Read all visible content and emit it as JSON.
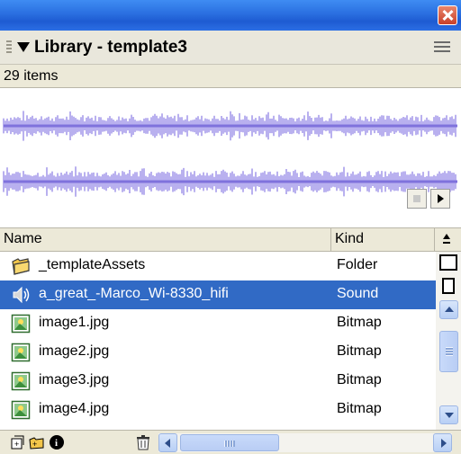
{
  "panel": {
    "title": "Library - template3",
    "item_count": "29 items"
  },
  "columns": {
    "name": "Name",
    "kind": "Kind"
  },
  "items": [
    {
      "name": "_templateAssets",
      "kind": "Folder",
      "icon": "folder-icon",
      "selected": false
    },
    {
      "name": "a_great_-Marco_Wi-8330_hifi",
      "kind": "Sound",
      "icon": "sound-icon",
      "selected": true
    },
    {
      "name": "image1.jpg",
      "kind": "Bitmap",
      "icon": "bitmap-icon",
      "selected": false
    },
    {
      "name": "image2.jpg",
      "kind": "Bitmap",
      "icon": "bitmap-icon",
      "selected": false
    },
    {
      "name": "image3.jpg",
      "kind": "Bitmap",
      "icon": "bitmap-icon",
      "selected": false
    },
    {
      "name": "image4.jpg",
      "kind": "Bitmap",
      "icon": "bitmap-icon",
      "selected": false
    }
  ],
  "colors": {
    "title_bar": "#2a6fe0",
    "selection": "#316ac5",
    "waveform": "#9b8fe8",
    "panel_bg": "#ece9d8"
  },
  "icons": [
    "close-icon",
    "collapse-arrow-icon",
    "panel-menu-icon",
    "stop-icon",
    "play-icon",
    "sort-icon",
    "new-symbol-icon",
    "new-folder-icon",
    "properties-icon",
    "delete-icon"
  ]
}
